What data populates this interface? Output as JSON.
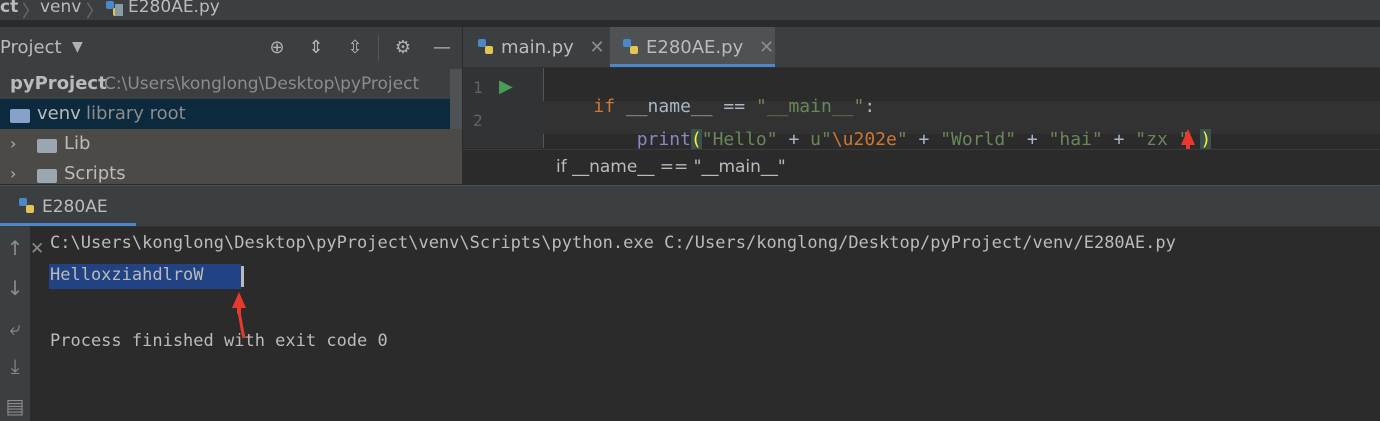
{
  "breadcrumb": {
    "items": [
      "ct",
      "venv",
      "E280AE.py"
    ]
  },
  "project_panel": {
    "title": "Project",
    "toolbar_icons": [
      "locate-icon",
      "expand-all-icon",
      "collapse-all-icon",
      "gear-icon",
      "minimize-icon"
    ],
    "tree": [
      {
        "name": "pyProject",
        "detail": "C:\\Users\\konglong\\Desktop\\pyProject"
      },
      {
        "name": "venv",
        "detail": "library root"
      },
      {
        "name": "Lib",
        "detail": ""
      },
      {
        "name": "Scripts",
        "detail": ""
      }
    ]
  },
  "editor": {
    "tabs": [
      {
        "label": "main.py",
        "active": false
      },
      {
        "label": "E280AE.py",
        "active": true
      }
    ],
    "line_numbers": [
      "1",
      "2"
    ],
    "code": {
      "l1": {
        "kw": "if",
        "t1": " __name__ == ",
        "s1": "\"__main__\"",
        "t2": ":"
      },
      "l2": {
        "indent": "    ",
        "fn": "print",
        "p1": "(",
        "s1": "\"Hello\"",
        "plus1": " + ",
        "u": "u\"",
        "esc": "\\u202e",
        "q": "\"",
        "plus2": " + ",
        "s2": "\"World\"",
        "plus3": " + ",
        "s3": "\"hai\"",
        "plus4": " + ",
        "s4": "\"zx \"",
        "sp": " ",
        "p2": ")"
      }
    },
    "breadcrumb_bar": "if __name__ == \"__main__\""
  },
  "run_panel": {
    "tab_label": "E280AE",
    "lines": [
      "C:\\Users\\konglong\\Desktop\\pyProject\\venv\\Scripts\\python.exe C:/Users/konglong/Desktop/pyProject/venv/E280AE.py",
      "HelloxziahdlroW",
      "",
      "Process finished with exit code 0"
    ],
    "side_icons": [
      "up-arrow-icon",
      "down-arrow-icon",
      "soft-wrap-icon",
      "scroll-to-end-icon",
      "print-icon"
    ]
  },
  "colors": {
    "accent": "#4a88c7",
    "selection": "#214283",
    "annotation_arrow": "#e8392e"
  }
}
